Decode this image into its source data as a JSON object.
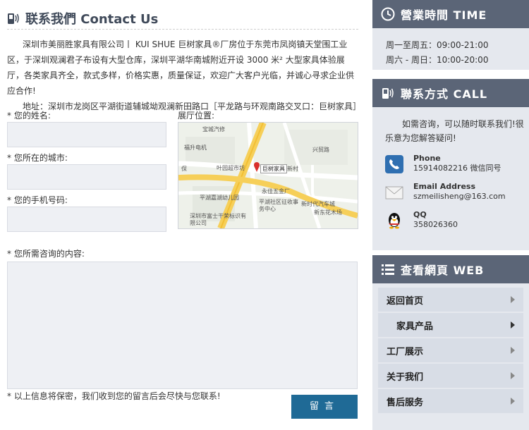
{
  "contact": {
    "title": "联系我們 Contact Us",
    "intro": "深圳市美丽胜家具有限公司丨 KUI SHUE 巨树家具®厂房位于东莞市凤岗镇天堂围工业区，于深圳观澜君子布设有大型仓库，深圳平湖华南城附近开设 3000 米² 大型家具体验展厅，各类家具齐全，款式多样，价格实惠，质量保证，欢迎广大客户光临，并诚心寻求企业供应合作!",
    "address": "地址：深圳市龙岗区平湖街道辅城坳观澜新田路口［平龙路与环观南路交叉口：巨树家具］"
  },
  "form": {
    "name_label": "* 您的姓名:",
    "city_label": "* 您所在的城市:",
    "phone_label": "* 您的手机号码:",
    "showroom_label": "展厅位置:",
    "content_label": "* 您所需咨询的内容:",
    "note": "* 以上信息将保密，我们收到您的留言后会尽快与您联系!",
    "submit": "留言"
  },
  "map": {
    "labels": [
      "宝城汽修",
      "福升电机",
      "兴贸路",
      "叶园超市坊",
      "观新村",
      "巨树家具",
      "永佳五金厂",
      "平湖嘉湖幼儿园",
      "平湖社区征收事务中心",
      "新时代汽车城",
      "新东花木场",
      "深圳市富士干荣标识有限公司",
      "保"
    ]
  },
  "sidebar": {
    "time": {
      "title": "營業時間 TIME",
      "weekday": "周一至周五：09:00-21:00",
      "weekend": "周六 - 周日：10:00-20:00"
    },
    "call": {
      "title": "聯系方式 CALL",
      "intro": "如需咨询，可以随时联系我们!很乐意为您解答疑问!",
      "phone_title": "Phone",
      "phone_value": "15914082216 微信同号",
      "email_title": "Email Address",
      "email_value": "szmeilisheng@163.com",
      "qq_title": "QQ",
      "qq_value": "358026360"
    },
    "web": {
      "title": "查看網頁 WEB",
      "items": [
        {
          "label": "返回首页"
        },
        {
          "label": "家具产品"
        },
        {
          "label": "工厂展示"
        },
        {
          "label": "关于我们"
        },
        {
          "label": "售后服务"
        }
      ]
    }
  },
  "colors": {
    "sidebar_header": "#5b6577",
    "sidebar_body": "#e5e8ee",
    "nav_item": "#d8dde6",
    "submit": "#1f6a96",
    "input_bg": "#eef0f4"
  }
}
